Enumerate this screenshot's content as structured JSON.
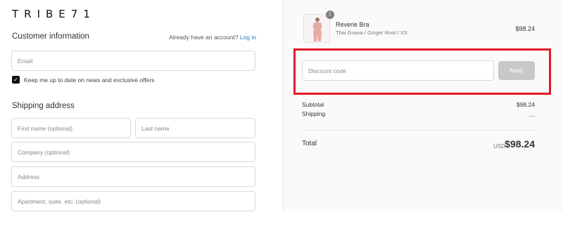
{
  "brand": {
    "logo": "TRIBE71"
  },
  "customer": {
    "title": "Customer information",
    "account_prompt": "Already have an account?",
    "login_link": "Log in",
    "email_placeholder": "Email",
    "newsletter_label": "Keep me up to date on news and exclusive offers",
    "newsletter_checked": true
  },
  "shipping": {
    "title": "Shipping address",
    "first_name_placeholder": "First name (optional)",
    "last_name_placeholder": "Last name",
    "company_placeholder": "Company (optional)",
    "address_placeholder": "Address",
    "apartment_placeholder": "Apartment, suite, etc. (optional)"
  },
  "order": {
    "item": {
      "quantity": "1",
      "name": "Reverie Bra",
      "variant": "Thai Guava / Ginger Root / XS",
      "price": "$98.24",
      "thumbnail_color": "#e8a9a3"
    },
    "discount": {
      "placeholder": "Discount code",
      "apply_label": "Apply"
    },
    "subtotal_label": "Subtotal",
    "subtotal_value": "$98.24",
    "shipping_label": "Shipping",
    "shipping_value": "—",
    "total_label": "Total",
    "currency": "USD",
    "total_value": "$98.24"
  },
  "colors": {
    "highlight": "#e01b24",
    "link": "#197bbd"
  }
}
